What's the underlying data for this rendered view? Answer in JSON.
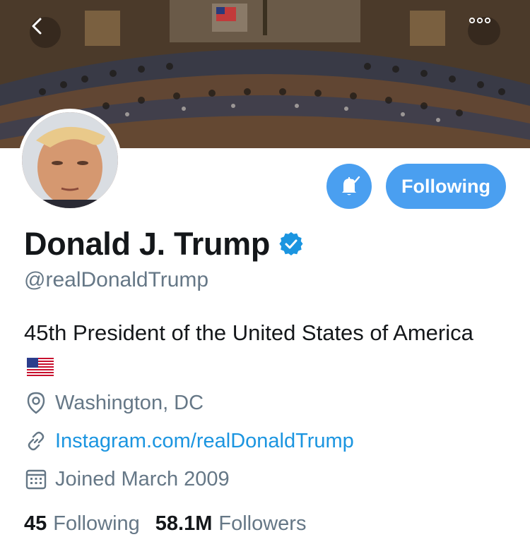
{
  "header": {
    "back_icon": "chevron-left-icon",
    "more_icon": "more-dots-icon"
  },
  "actions": {
    "notifications_icon": "bell-check-icon",
    "follow_label": "Following"
  },
  "profile": {
    "name": "Donald J. Trump",
    "verified_icon": "verified-badge-icon",
    "handle": "@realDonaldTrump",
    "bio": "45th President of the United States of America",
    "bio_flag_icon": "us-flag-icon",
    "location": "Washington, DC",
    "website": "Instagram.com/realDonaldTrump",
    "joined": "Joined March 2009"
  },
  "stats": {
    "following_count": "45",
    "following_label": "Following",
    "followers_count": "58.1M",
    "followers_label": "Followers"
  },
  "colors": {
    "accent": "#4a9ff0",
    "link": "#1b95e0",
    "secondary_text": "#657786",
    "primary_text": "#14171a"
  }
}
